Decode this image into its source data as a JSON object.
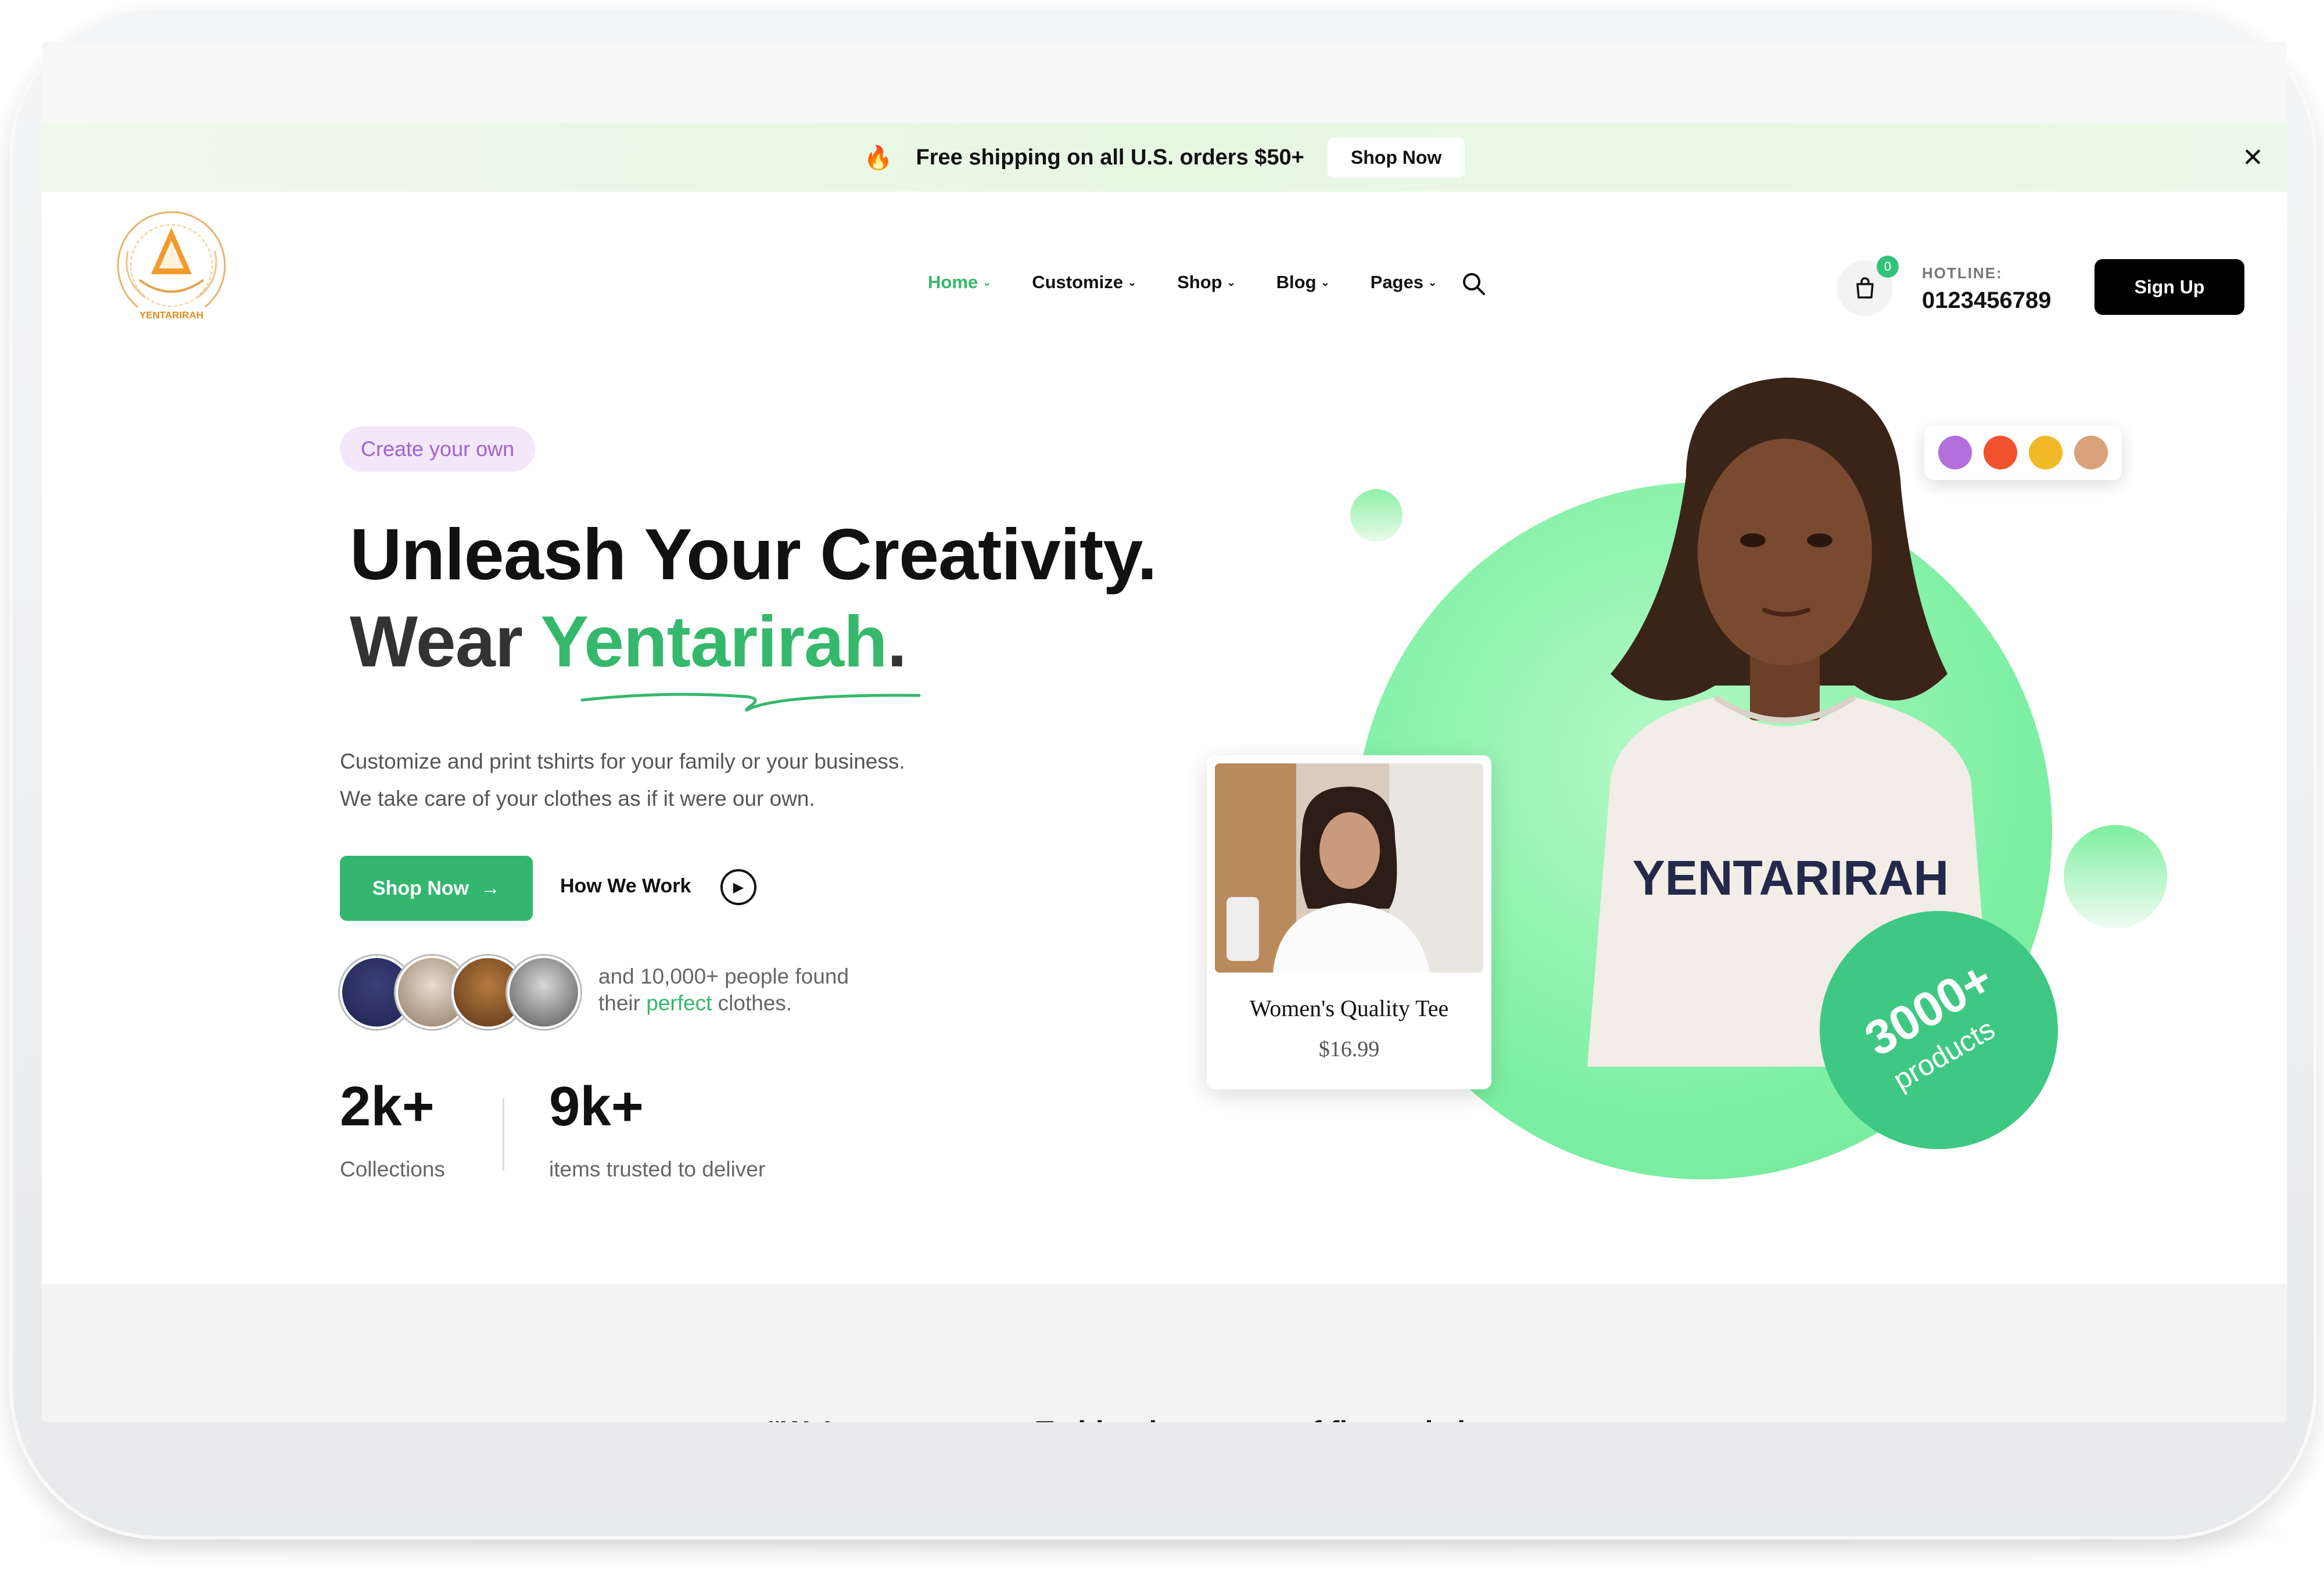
{
  "announcement": {
    "text": "Free shipping on all U.S. orders $50+",
    "button": "Shop Now",
    "close": "✕"
  },
  "header": {
    "logo_text": "YENTARIRAH",
    "nav": [
      {
        "label": "Home",
        "active": true
      },
      {
        "label": "Customize",
        "active": false
      },
      {
        "label": "Shop",
        "active": false
      },
      {
        "label": "Blog",
        "active": false
      },
      {
        "label": "Pages",
        "active": false
      }
    ],
    "cart_count": "0",
    "hotline_label": "HOTLINE:",
    "hotline_number": "0123456789",
    "signup": "Sign Up"
  },
  "hero": {
    "pill": "Create your own",
    "title_line1": "Unleash Your Creativity.",
    "title_line2_prefix": "Wear ",
    "title_line2_brand": "Yentarirah",
    "title_line2_suffix": ".",
    "subtitle_line1": "Customize and print tshirts for your family or your business.",
    "subtitle_line2": "We take care of your clothes as if it were our own.",
    "shop_button": "Shop Now",
    "shop_button_arrow": "→",
    "how_we_work": "How We Work",
    "social_line1": "and 10,000+ people found",
    "social_line2_prefix": "their ",
    "social_line2_highlight": "perfect",
    "social_line2_suffix": " clothes.",
    "stats": [
      {
        "value": "2k+",
        "label": "Collections"
      },
      {
        "value": "9k+",
        "label": "items trusted to deliver"
      }
    ],
    "shirt_text": "YENTARIRAH",
    "product_card": {
      "name": "Women's Quality Tee",
      "price": "$16.99"
    },
    "badge": {
      "big": "3000+",
      "small": "products"
    },
    "swatch_colors": [
      "#b36fdc",
      "#f2512e",
      "#f1b928",
      "#d9a27a"
    ]
  },
  "testimonial": {
    "quote": "“We've got custom T-shirts in a range of fits and sizes, so"
  },
  "colors": {
    "accent": "#35b86c",
    "primary_dark": "#000000"
  }
}
